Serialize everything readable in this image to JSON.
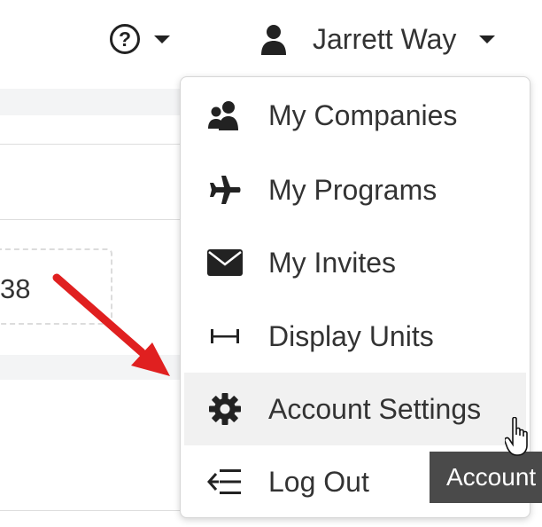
{
  "header": {
    "help_icon": "question-circle-icon",
    "user_icon": "user-icon",
    "user_name": "Jarrett Way"
  },
  "background": {
    "partial_value": "38"
  },
  "menu": {
    "items": [
      {
        "label": "My Companies",
        "icon": "users-icon"
      },
      {
        "label": "My Programs",
        "icon": "plane-icon"
      },
      {
        "label": "My Invites",
        "icon": "envelope-icon"
      },
      {
        "label": "Display Units",
        "icon": "ruler-horizontal-icon"
      },
      {
        "label": "Account Settings",
        "icon": "gear-icon"
      },
      {
        "label": "Log Out",
        "icon": "sign-out-icon"
      }
    ],
    "hovered_item": "Account Settings"
  },
  "tooltip": {
    "text": "Account"
  },
  "annotation": {
    "arrow_color": "#e02020"
  },
  "cursor": {
    "type": "hand-pointer-icon"
  }
}
